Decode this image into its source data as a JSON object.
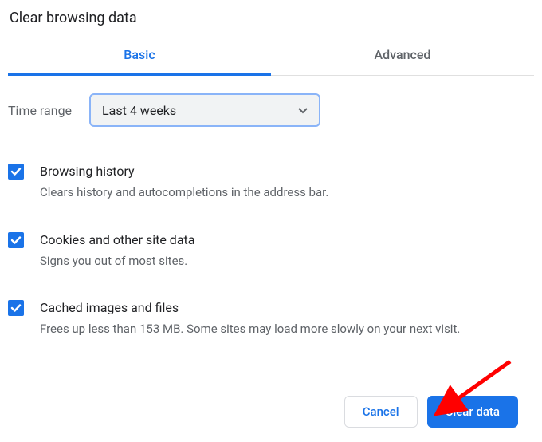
{
  "title": "Clear browsing data",
  "tabs": {
    "basic": "Basic",
    "advanced": "Advanced"
  },
  "time_range": {
    "label": "Time range",
    "value": "Last 4 weeks"
  },
  "options": [
    {
      "title": "Browsing history",
      "desc": "Clears history and autocompletions in the address bar.",
      "checked": true
    },
    {
      "title": "Cookies and other site data",
      "desc": "Signs you out of most sites.",
      "checked": true
    },
    {
      "title": "Cached images and files",
      "desc": "Frees up less than 153 MB. Some sites may load more slowly on your next visit.",
      "checked": true
    }
  ],
  "buttons": {
    "cancel": "Cancel",
    "clear": "Clear data"
  },
  "colors": {
    "accent": "#1a73e8",
    "arrow": "#ff0000"
  }
}
